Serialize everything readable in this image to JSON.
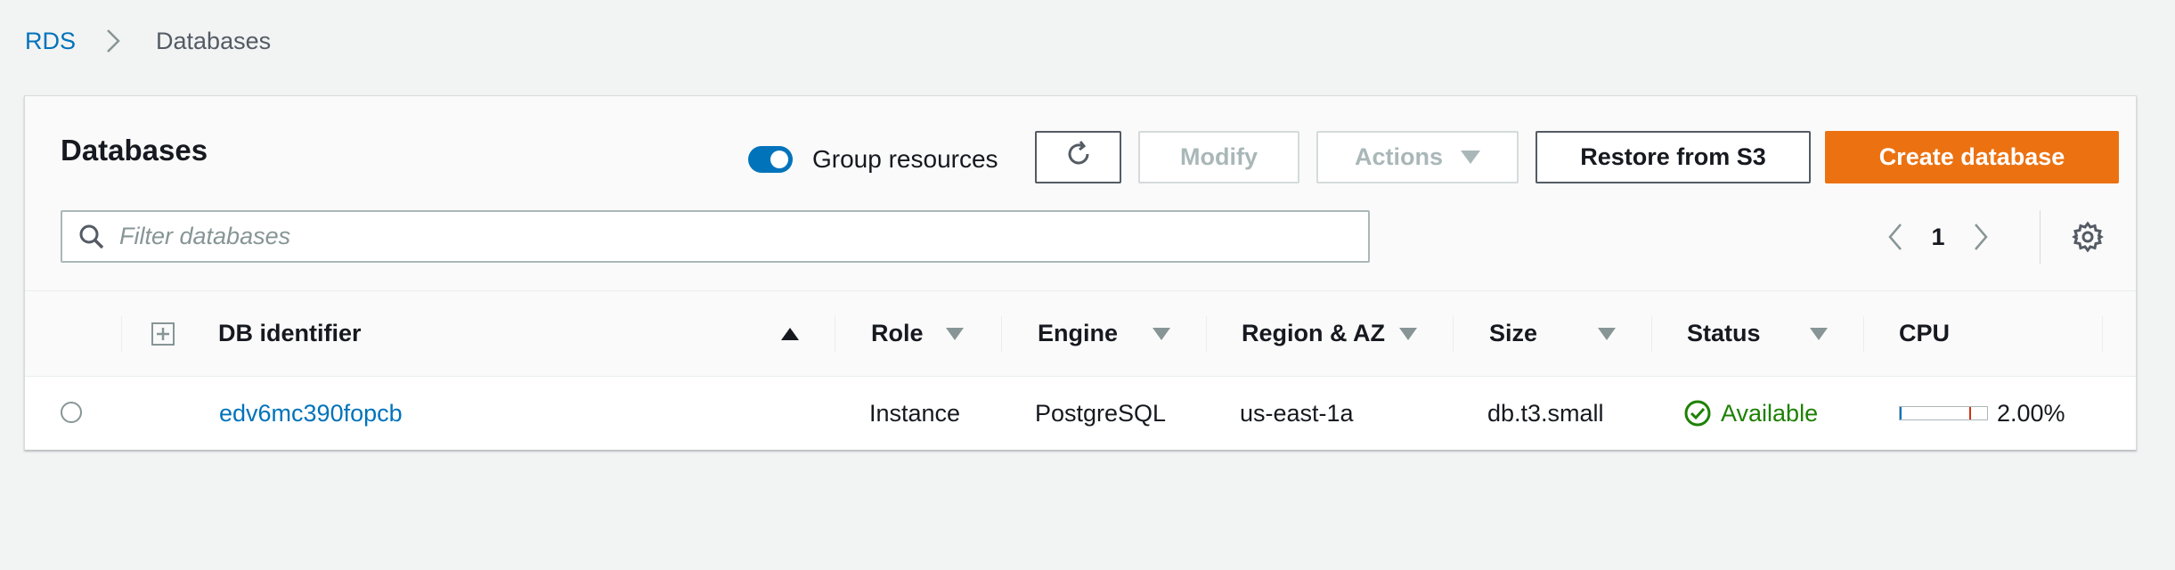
{
  "breadcrumb": {
    "root": "RDS",
    "current": "Databases"
  },
  "panel": {
    "title": "Databases",
    "group_resources_label": "Group resources",
    "group_resources_on": true
  },
  "toolbar": {
    "modify_label": "Modify",
    "actions_label": "Actions",
    "restore_label": "Restore from S3",
    "create_label": "Create database"
  },
  "search": {
    "placeholder": "Filter databases",
    "value": ""
  },
  "pagination": {
    "current_page": "1"
  },
  "table": {
    "columns": {
      "identifier": "DB identifier",
      "role": "Role",
      "engine": "Engine",
      "region": "Region & AZ",
      "size": "Size",
      "status": "Status",
      "cpu": "CPU"
    },
    "rows": [
      {
        "identifier": "edv6mc390fopcb",
        "role": "Instance",
        "engine": "PostgreSQL",
        "region": "us-east-1a",
        "size": "db.t3.small",
        "status": "Available",
        "cpu": "2.00%",
        "cpu_fraction": 0.02
      }
    ]
  },
  "colors": {
    "link": "#0073bb",
    "primary": "#ec7211",
    "success": "#1d8102"
  }
}
